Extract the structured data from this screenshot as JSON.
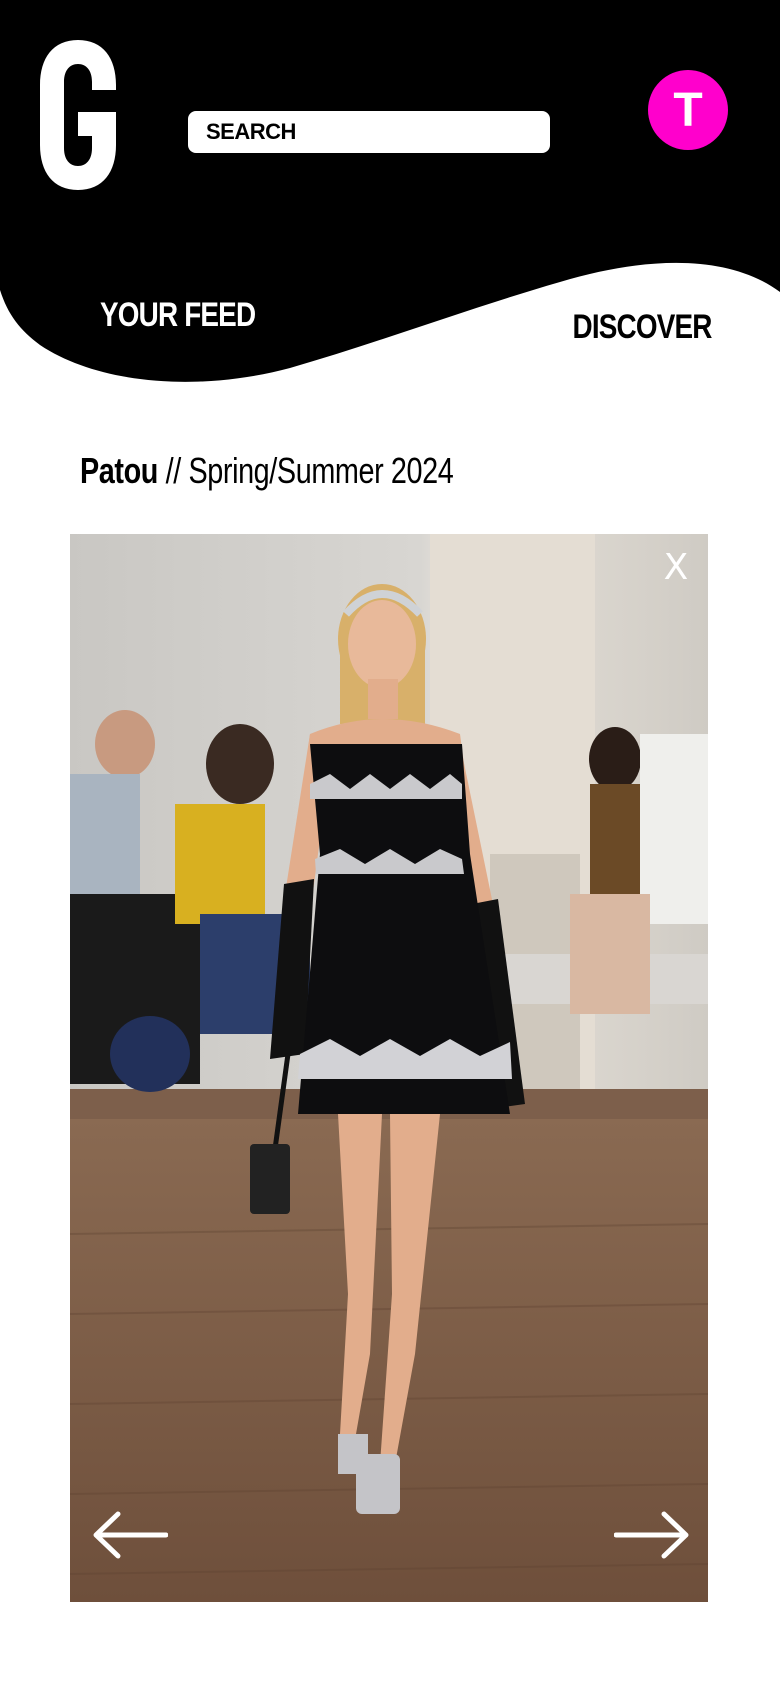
{
  "header": {
    "logo_letter": "G",
    "search": {
      "placeholder": "SEARCH",
      "value": ""
    },
    "avatar_initial": "T",
    "avatar_color": "#ff00cc"
  },
  "nav": {
    "feed_label": "YOUR FEED",
    "discover_label": "DISCOVER"
  },
  "collection": {
    "brand": "Patou",
    "separator": "//",
    "season": "Spring/Summer 2024"
  },
  "viewer": {
    "close_label": "X",
    "prev_icon": "arrow-left-icon",
    "next_icon": "arrow-right-icon"
  },
  "colors": {
    "header_bg": "#000000",
    "accent": "#ff00cc",
    "page_bg": "#ffffff"
  }
}
